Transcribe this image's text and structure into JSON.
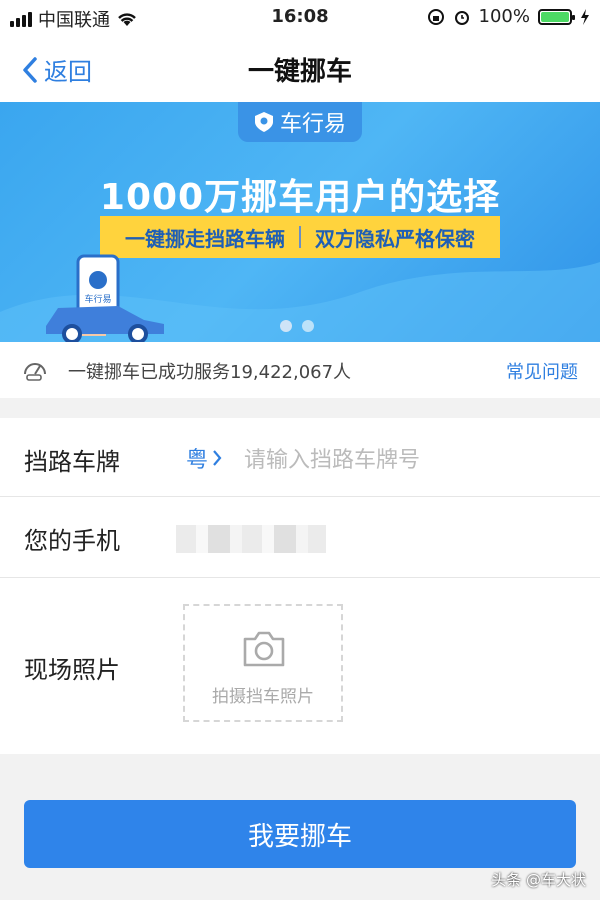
{
  "status": {
    "carrier": "中国联通",
    "time": "16:08",
    "battery": "100%"
  },
  "nav": {
    "back_label": "返回",
    "title": "一键挪车"
  },
  "banner": {
    "brand": "车行易",
    "headline": "1000万挪车用户的选择",
    "tag_left": "一键挪走挡路车辆",
    "tag_right": "双方隐私严格保密",
    "phone_brand": "车行易",
    "slide_count": 2
  },
  "service": {
    "text": "一键挪车已成功服务19,422,067人",
    "faq": "常见问题"
  },
  "form": {
    "plate_label": "挡路车牌",
    "province": "粤",
    "plate_placeholder": "请输入挡路车牌号",
    "phone_label": "您的手机",
    "photo_label": "现场照片",
    "photo_caption": "拍摄挡车照片"
  },
  "submit_label": "我要挪车",
  "watermark": "头条 @车大状",
  "colors": {
    "accent": "#2f84ea",
    "banner": "#3aa6ef",
    "tag": "#ffd33d"
  }
}
